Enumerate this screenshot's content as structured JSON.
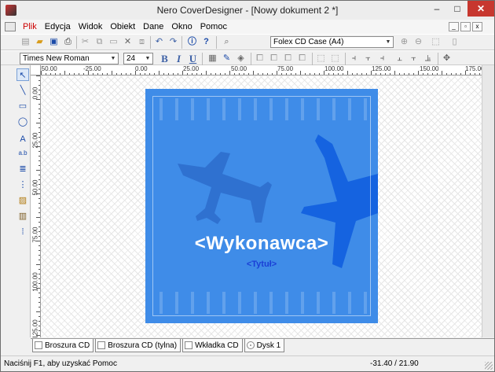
{
  "window": {
    "title": "Nero CoverDesigner - [Nowy dokument 2 *]",
    "min": "–",
    "max": "□",
    "close": "✕"
  },
  "menu": [
    "Plik",
    "Edycja",
    "Widok",
    "Obiekt",
    "Dane",
    "Okno",
    "Pomoc"
  ],
  "mdi": {
    "min": "_",
    "max": "▫",
    "close": "x"
  },
  "toolbar": {
    "case_select": "Folex CD Case (A4)"
  },
  "format": {
    "font": "Times New Roman",
    "size": "24",
    "bold": "B",
    "italic": "I",
    "underline": "U"
  },
  "ruler": {
    "h_labels": [
      "-50.00",
      "-25.00",
      "0.00",
      "25.00",
      "50.00",
      "75.00",
      "100.00",
      "125.00",
      "150.00",
      "175.00"
    ],
    "v_labels": [
      "0.00",
      "25.00",
      "50.00",
      "75.00",
      "100.00",
      "125.00"
    ]
  },
  "cover": {
    "artist": "<Wykonawca>",
    "title": "<Tytuł>",
    "bg": "#3f8ce8"
  },
  "tabs": [
    {
      "label": "Broszura CD"
    },
    {
      "label": "Broszura CD (tylna)"
    },
    {
      "label": "Wkładka CD"
    },
    {
      "label": "Dysk 1"
    }
  ],
  "status": {
    "text": "Naciśnij F1, aby uzyskać Pomoc",
    "coords": "-31.40 / 21.90"
  }
}
